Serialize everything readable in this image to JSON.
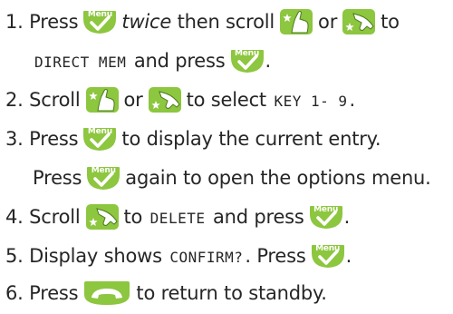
{
  "steps": {
    "s1": {
      "num": "1.",
      "a": "Press",
      "b": "twice",
      "c": "then scroll",
      "d": "or",
      "e": "to"
    },
    "s1b": {
      "a": "DIRECT MEM",
      "b": "and press",
      "end": "."
    },
    "s2": {
      "num": "2.",
      "a": "Scroll",
      "b": "or",
      "c": "to select",
      "d": "KEY 1- 9",
      "end": "."
    },
    "s3": {
      "num": "3.",
      "a": "Press",
      "b": "to display the current entry."
    },
    "s3b": {
      "a": "Press",
      "b": "again to open the options menu."
    },
    "s4": {
      "num": "4.",
      "a": "Scroll",
      "b": "to",
      "c": "DELETE",
      "d": "and press",
      "end": "."
    },
    "s5": {
      "num": "5.",
      "a": "Display shows",
      "b": "CONFIRM?",
      "c": ". Press",
      "end": "."
    },
    "s6": {
      "num": "6.",
      "a": "Press",
      "b": "to return to standby."
    }
  },
  "keys": {
    "menu_label": "Menu",
    "menu_color": "#8dc63f",
    "scroll_color": "#8dc63f",
    "phone_color": "#8dc63f",
    "icons": [
      "menu-ok-key",
      "scroll-up-key",
      "scroll-down-key",
      "end-call-key"
    ]
  }
}
